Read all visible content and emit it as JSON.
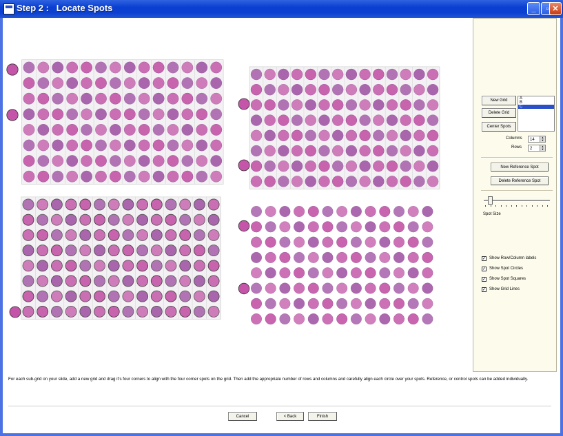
{
  "window": {
    "title": "Step 2 :   Locate Spots"
  },
  "side_panel": {
    "new_grid": "New Grid",
    "delete_grid": "Delete Grid",
    "center_spots": "Center Spots",
    "grid_list": [
      "A",
      "B",
      "C"
    ],
    "columns_label": "Columns",
    "columns_value": "14",
    "rows_label": "Rows",
    "rows_value": "2",
    "new_reference_spot": "New Reference Spot",
    "delete_reference_spot": "Delete Reference Spot",
    "spot_size_label": "Spot Size",
    "checkboxes": [
      {
        "label": "Show Row/Column labels",
        "checked": true
      },
      {
        "label": "Show Spot Circles",
        "checked": true
      },
      {
        "label": "Show Spot Squares",
        "checked": true
      },
      {
        "label": "Show Grid Lines",
        "checked": true
      }
    ]
  },
  "instructions": "For each sub-grid on your slide, add a new grid and drag it's four corners to align with the four corner spots on the grid.  Then add the appropriate number of rows and columns and carefully align each circle over your spots.  Reference, or control spots can be added individually.",
  "footer": {
    "cancel": "Cancel",
    "back": "< Back",
    "finish": "Finish"
  },
  "colors": {
    "spot_a": "#9b4aa0",
    "spot_b": "#c455a8",
    "titlebar": "#0b40cf"
  }
}
